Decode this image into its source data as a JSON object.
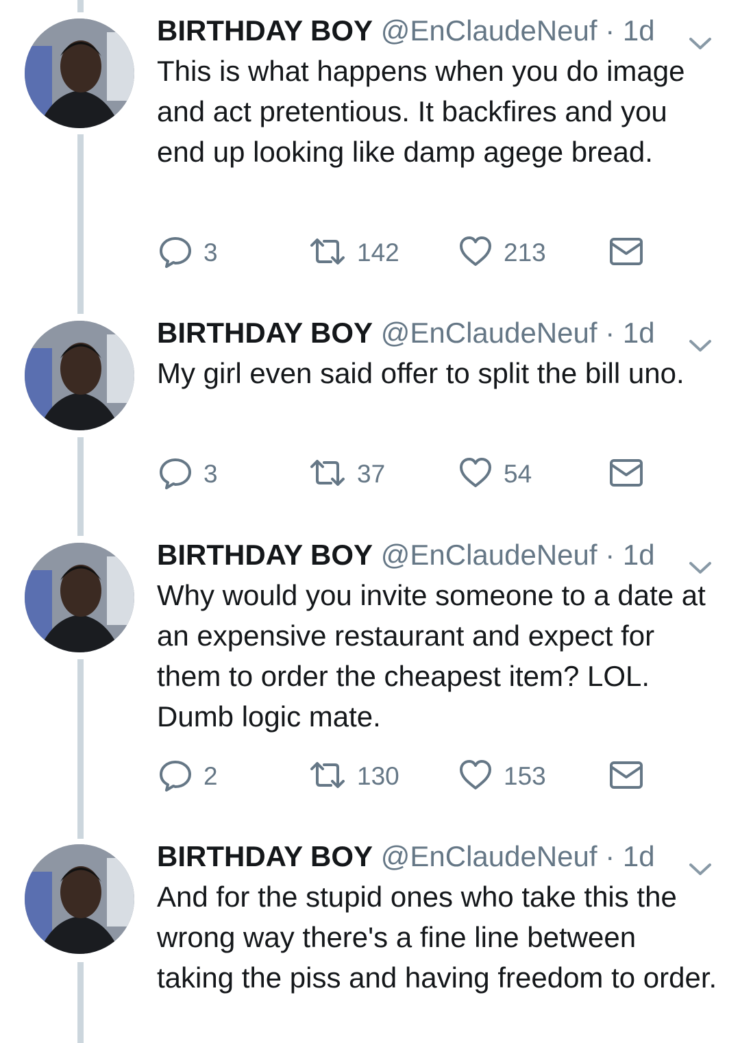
{
  "tweets": [
    {
      "name": "BIRTHDAY BOY",
      "handle": "@EnClaudeNeuf",
      "dot": "·",
      "time": "1d",
      "text": "This is what happens when you do image and act pretentious. It backfires and you end up looking like damp agege bread.",
      "replies": "3",
      "retweets": "142",
      "likes": "213"
    },
    {
      "name": "BIRTHDAY BOY",
      "handle": "@EnClaudeNeuf",
      "dot": "·",
      "time": "1d",
      "text": "My girl even said offer to split the bill uno.",
      "replies": "3",
      "retweets": "37",
      "likes": "54"
    },
    {
      "name": "BIRTHDAY BOY",
      "handle": "@EnClaudeNeuf",
      "dot": "·",
      "time": "1d",
      "text": "Why would you invite someone to a date at an expensive restaurant and expect for them to order the cheapest item? LOL. Dumb logic mate.",
      "replies": "2",
      "retweets": "130",
      "likes": "153"
    },
    {
      "name": "BIRTHDAY BOY",
      "handle": "@EnClaudeNeuf",
      "dot": "·",
      "time": "1d",
      "text": "And for the stupid ones who take this the wrong way there's a fine line between taking the piss and having freedom to order."
    }
  ],
  "colors": {
    "text": "#14171a",
    "secondary": "#657786",
    "thread_line": "#ccd6dd"
  },
  "icons": [
    "reply-icon",
    "retweet-icon",
    "like-icon",
    "direct-message-icon",
    "chevron-down-icon"
  ]
}
